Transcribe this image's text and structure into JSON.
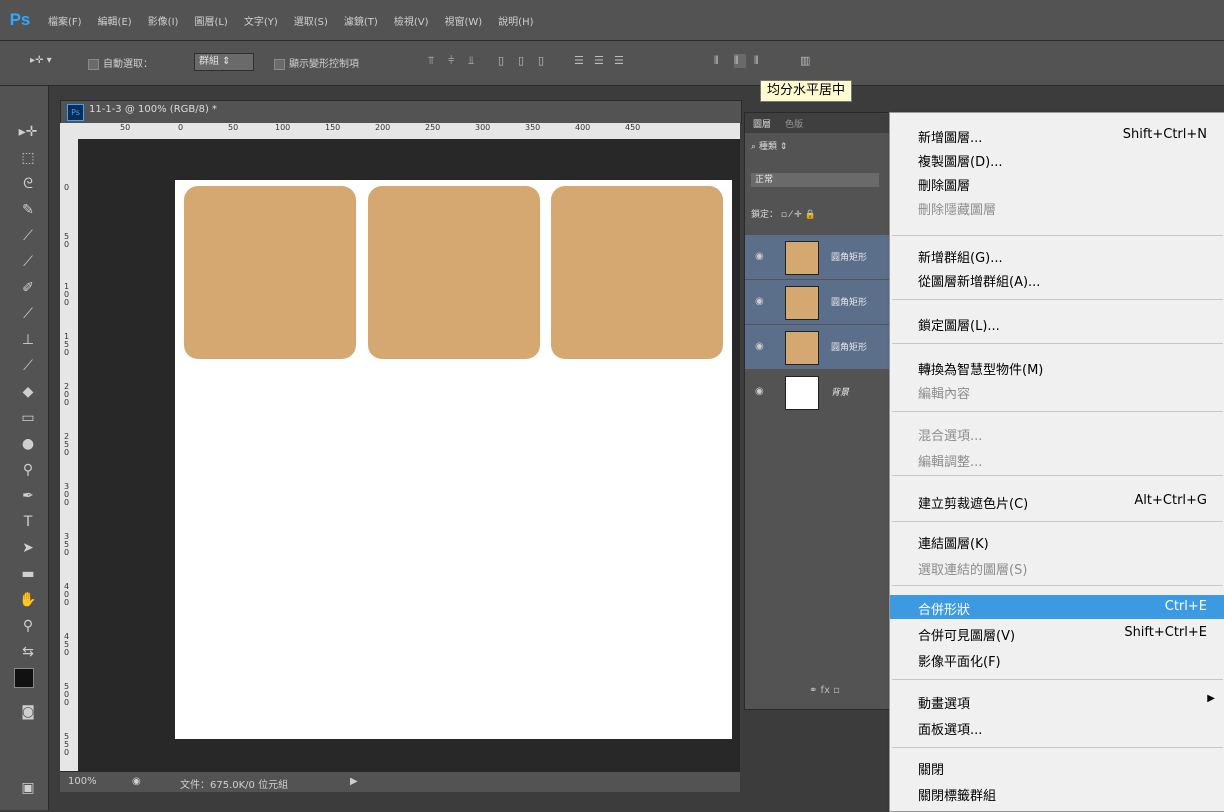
{
  "app": {
    "logo": "Ps"
  },
  "menubar": [
    "檔案(F)",
    "編輯(E)",
    "影像(I)",
    "圖層(L)",
    "文字(Y)",
    "選取(S)",
    "濾鏡(T)",
    "檢視(V)",
    "視窗(W)",
    "說明(H)"
  ],
  "options": {
    "auto_select_label": "自動選取：",
    "auto_select_value": "群組",
    "show_transform_label": "顯示變形控制項",
    "tooltip": "均分水平居中"
  },
  "document": {
    "title": "11-1-3 @ 100% (RGB/8) *",
    "zoom": "100%",
    "file_info": "文件：675.0K/0 位元組",
    "ruler_h": [
      "50",
      "0",
      "50",
      "100",
      "150",
      "200",
      "250",
      "300",
      "350",
      "400",
      "450"
    ],
    "ruler_v": [
      "0",
      "5\n0",
      "1\n0\n0",
      "1\n5\n0",
      "2\n0\n0",
      "2\n5\n0",
      "3\n0\n0",
      "3\n5\n0",
      "4\n0\n0",
      "4\n5\n0",
      "5\n0\n0",
      "5\n5\n0"
    ],
    "shape_color": "#d4a870"
  },
  "layers_panel": {
    "tabs": [
      "圖層",
      "色版"
    ],
    "filter_label": "種類",
    "blend_mode": "正常",
    "lock_label": "鎖定：",
    "layers": [
      {
        "name": "圓角矩形",
        "selected": true
      },
      {
        "name": "圓角矩形",
        "selected": true
      },
      {
        "name": "圓角矩形",
        "selected": true
      },
      {
        "name": "背景",
        "selected": false
      }
    ]
  },
  "context_menu": {
    "items": [
      {
        "label": "新增圖層...",
        "shortcut": "Shift+Ctrl+N",
        "disabled": false
      },
      {
        "label": "複製圖層(D)...",
        "shortcut": "",
        "disabled": false
      },
      {
        "label": "刪除圖層",
        "shortcut": "",
        "disabled": false
      },
      {
        "label": "刪除隱藏圖層",
        "shortcut": "",
        "disabled": true
      },
      {
        "label": "新增群組(G)...",
        "shortcut": "",
        "disabled": false
      },
      {
        "label": "從圖層新增群組(A)...",
        "shortcut": "",
        "disabled": false
      },
      {
        "label": "鎖定圖層(L)...",
        "shortcut": "",
        "disabled": false
      },
      {
        "label": "轉換為智慧型物件(M)",
        "shortcut": "",
        "disabled": false
      },
      {
        "label": "編輯內容",
        "shortcut": "",
        "disabled": true
      },
      {
        "label": "混合選項...",
        "shortcut": "",
        "disabled": true
      },
      {
        "label": "編輯調整...",
        "shortcut": "",
        "disabled": true
      },
      {
        "label": "建立剪裁遮色片(C)",
        "shortcut": "Alt+Ctrl+G",
        "disabled": false
      },
      {
        "label": "連結圖層(K)",
        "shortcut": "",
        "disabled": false
      },
      {
        "label": "選取連結的圖層(S)",
        "shortcut": "",
        "disabled": true
      },
      {
        "label": "合併形狀",
        "shortcut": "Ctrl+E",
        "disabled": false,
        "highlighted": true
      },
      {
        "label": "合併可見圖層(V)",
        "shortcut": "Shift+Ctrl+E",
        "disabled": false
      },
      {
        "label": "影像平面化(F)",
        "shortcut": "",
        "disabled": false
      },
      {
        "label": "動畫選項",
        "shortcut": "",
        "disabled": false,
        "submenu": true
      },
      {
        "label": "面板選項...",
        "shortcut": "",
        "disabled": false
      },
      {
        "label": "關閉",
        "shortcut": "",
        "disabled": false
      },
      {
        "label": "關閉標籤群組",
        "shortcut": "",
        "disabled": false
      }
    ]
  }
}
